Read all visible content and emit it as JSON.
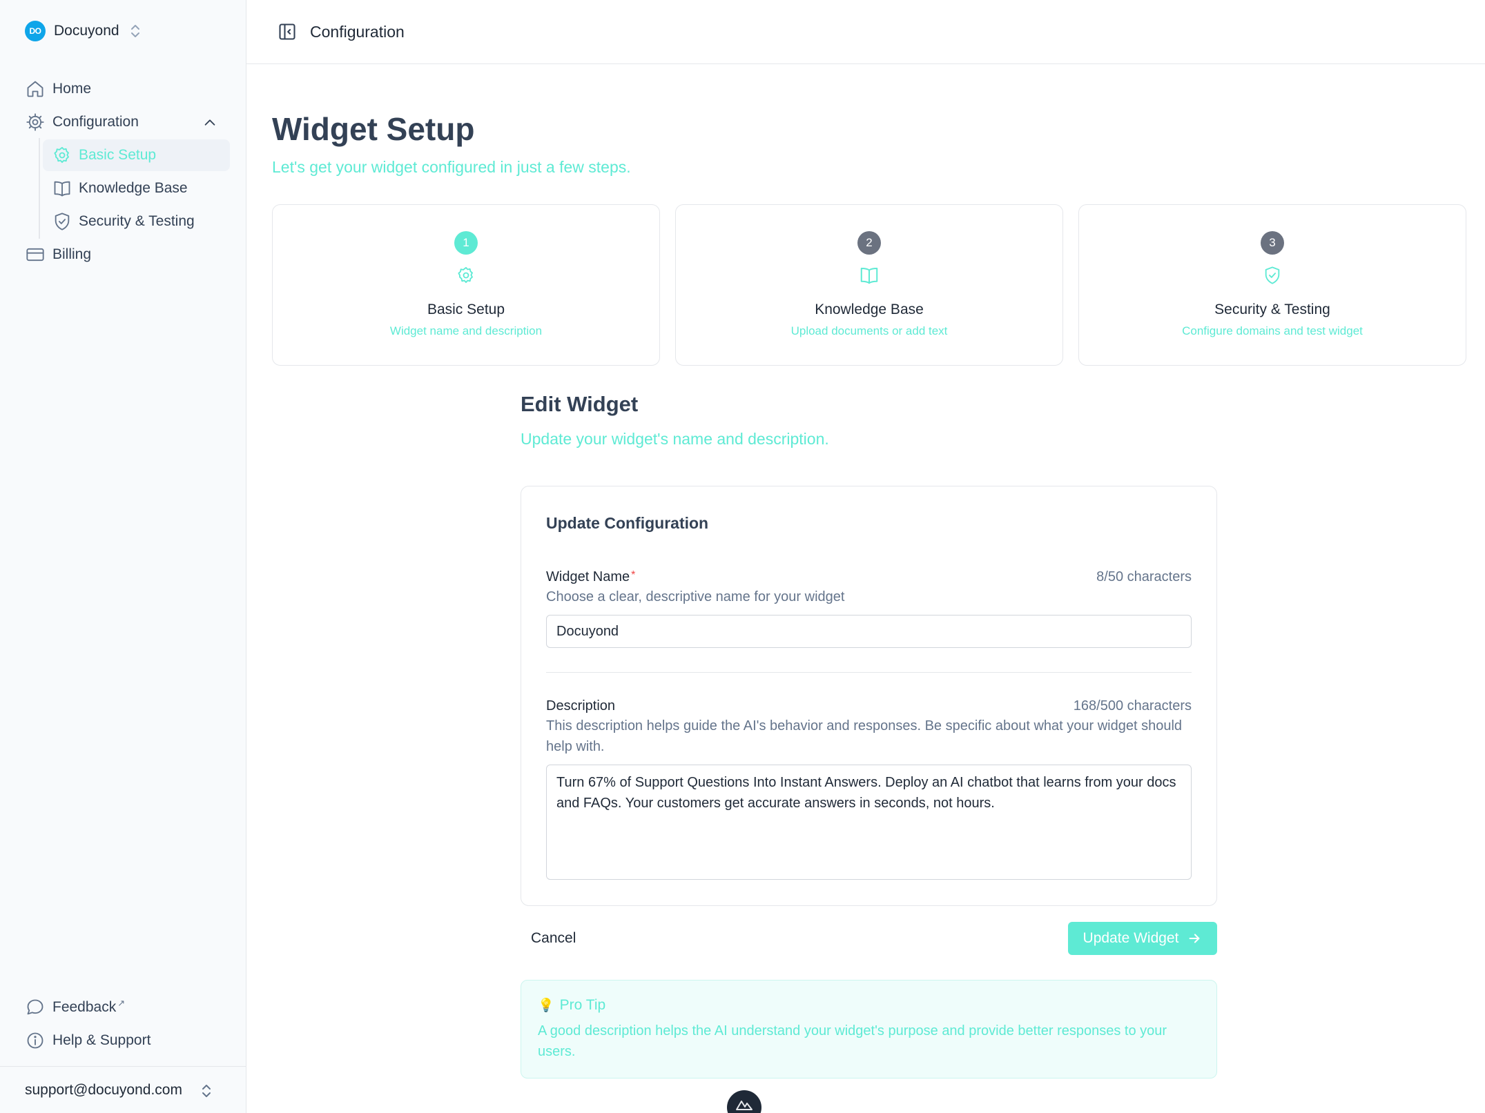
{
  "brand": {
    "logo_text": "DO",
    "name": "Docuyond"
  },
  "sidebar": {
    "nav": [
      {
        "label": "Home",
        "icon": "home-icon"
      },
      {
        "label": "Configuration",
        "icon": "gear-icon"
      },
      {
        "label": "Billing",
        "icon": "credit-card-icon"
      }
    ],
    "sub_items": [
      {
        "label": "Basic Setup",
        "icon": "gear-icon",
        "active": true
      },
      {
        "label": "Knowledge Base",
        "icon": "book-icon",
        "active": false
      },
      {
        "label": "Security & Testing",
        "icon": "shield-check-icon",
        "active": false
      }
    ],
    "bottom": [
      {
        "label": "Feedback",
        "icon": "chat-bubble-icon",
        "external": "↗"
      },
      {
        "label": "Help & Support",
        "icon": "info-icon"
      }
    ],
    "user_email": "support@docuyond.com"
  },
  "header": {
    "title": "Configuration"
  },
  "page": {
    "title": "Widget Setup",
    "subtitle": "Let's get your widget configured in just a few steps."
  },
  "steps": [
    {
      "number": "1",
      "title": "Basic Setup",
      "description": "Widget name and description",
      "icon": "gear-icon",
      "state": "active"
    },
    {
      "number": "2",
      "title": "Knowledge Base",
      "description": "Upload documents or add text",
      "icon": "book-icon",
      "state": "inactive"
    },
    {
      "number": "3",
      "title": "Security & Testing",
      "description": "Configure domains and test widget",
      "icon": "shield-check-icon",
      "state": "inactive"
    }
  ],
  "edit": {
    "title": "Edit Widget",
    "subtitle": "Update your widget's name and description."
  },
  "form": {
    "card_title": "Update Configuration",
    "name_label": "Widget Name",
    "name_required": "*",
    "name_count": "8/50 characters",
    "name_help": "Choose a clear, descriptive name for your widget",
    "name_value": "Docuyond",
    "desc_label": "Description",
    "desc_count": "168/500 characters",
    "desc_help": "This description helps guide the AI's behavior and responses. Be specific about what your widget should help with.",
    "desc_value": "Turn 67% of Support Questions Into Instant Answers. Deploy an AI chatbot that learns from your docs and FAQs. Your customers get accurate answers in seconds, not hours."
  },
  "actions": {
    "cancel_label": "Cancel",
    "update_label": "Update Widget"
  },
  "tip": {
    "title": "Pro Tip",
    "text": "A good description helps the AI understand your widget's purpose and provide better responses to your users."
  },
  "colors": {
    "accent": "#5eead4",
    "brand": "#0ea5e9",
    "inactive_step": "#6b7280"
  }
}
